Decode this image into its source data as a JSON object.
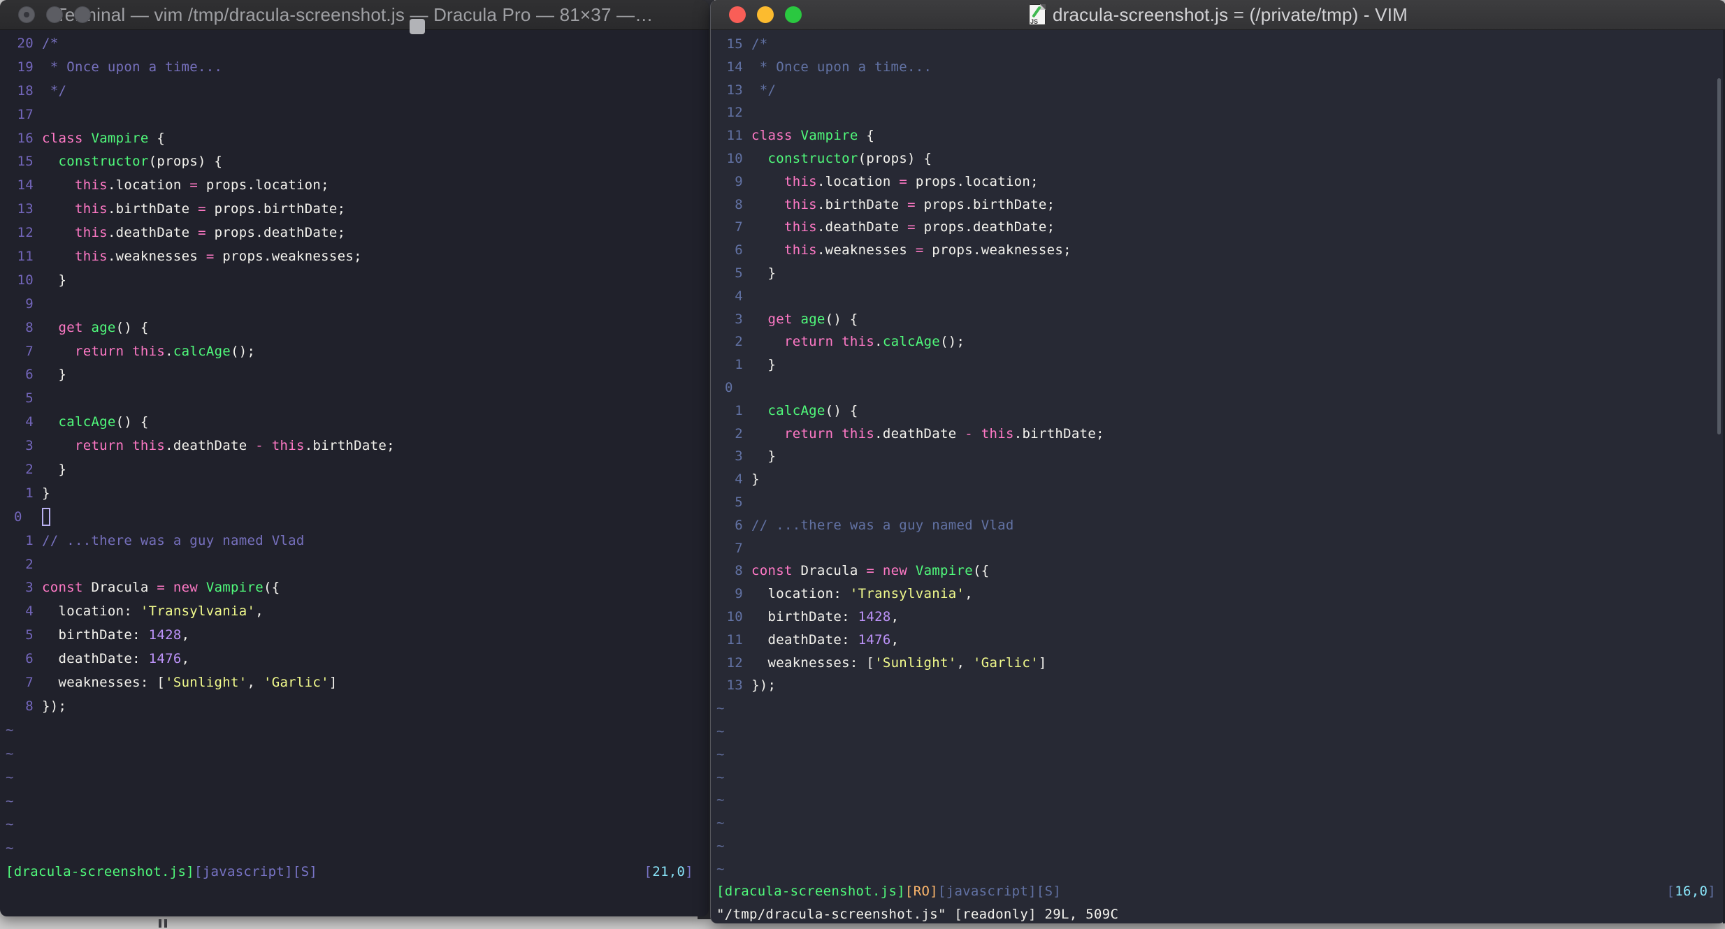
{
  "colors": {
    "left_background": "#20212b",
    "right_background": "#272934",
    "foreground": "#f4f3ee",
    "pink": "#ff79c6",
    "green": "#50fa7b",
    "yellow": "#f1fa8c",
    "purple": "#bd93f9",
    "left_comment": "#7670bd",
    "right_comment": "#6272a4",
    "cyan": "#8be9fd",
    "orange": "#ffb86c",
    "traffic_red": "#f95e57",
    "traffic_yellow": "#fcbb2f",
    "traffic_green": "#2ac840"
  },
  "tilde_char": "~",
  "code": {
    "lines": [
      [
        [
          "c",
          "/*"
        ]
      ],
      [
        [
          "c",
          " * Once upon a time..."
        ]
      ],
      [
        [
          "c",
          " */"
        ]
      ],
      [],
      [
        [
          "k",
          "class"
        ],
        [
          "d",
          " "
        ],
        [
          "f",
          "Vampire"
        ],
        [
          "d",
          " {"
        ]
      ],
      [
        [
          "d",
          "  "
        ],
        [
          "f",
          "constructor"
        ],
        [
          "d",
          "(props) {"
        ]
      ],
      [
        [
          "d",
          "    "
        ],
        [
          "k",
          "this"
        ],
        [
          "d",
          ".location "
        ],
        [
          "k",
          "="
        ],
        [
          "d",
          " props.location;"
        ]
      ],
      [
        [
          "d",
          "    "
        ],
        [
          "k",
          "this"
        ],
        [
          "d",
          ".birthDate "
        ],
        [
          "k",
          "="
        ],
        [
          "d",
          " props.birthDate;"
        ]
      ],
      [
        [
          "d",
          "    "
        ],
        [
          "k",
          "this"
        ],
        [
          "d",
          ".deathDate "
        ],
        [
          "k",
          "="
        ],
        [
          "d",
          " props.deathDate;"
        ]
      ],
      [
        [
          "d",
          "    "
        ],
        [
          "k",
          "this"
        ],
        [
          "d",
          ".weaknesses "
        ],
        [
          "k",
          "="
        ],
        [
          "d",
          " props.weaknesses;"
        ]
      ],
      [
        [
          "d",
          "  }"
        ]
      ],
      [],
      [
        [
          "d",
          "  "
        ],
        [
          "k",
          "get"
        ],
        [
          "d",
          " "
        ],
        [
          "f",
          "age"
        ],
        [
          "d",
          "() {"
        ]
      ],
      [
        [
          "d",
          "    "
        ],
        [
          "k",
          "return"
        ],
        [
          "d",
          " "
        ],
        [
          "k",
          "this"
        ],
        [
          "d",
          "."
        ],
        [
          "f",
          "calcAge"
        ],
        [
          "d",
          "();"
        ]
      ],
      [
        [
          "d",
          "  }"
        ]
      ],
      [],
      [
        [
          "d",
          "  "
        ],
        [
          "f",
          "calcAge"
        ],
        [
          "d",
          "() {"
        ]
      ],
      [
        [
          "d",
          "    "
        ],
        [
          "k",
          "return"
        ],
        [
          "d",
          " "
        ],
        [
          "k",
          "this"
        ],
        [
          "d",
          ".deathDate "
        ],
        [
          "k",
          "-"
        ],
        [
          "d",
          " "
        ],
        [
          "k",
          "this"
        ],
        [
          "d",
          ".birthDate;"
        ]
      ],
      [
        [
          "d",
          "  }"
        ]
      ],
      [
        [
          "d",
          "}"
        ]
      ],
      [],
      [
        [
          "c",
          "// ...there was a guy named Vlad"
        ]
      ],
      [],
      [
        [
          "k",
          "const"
        ],
        [
          "d",
          " Dracula "
        ],
        [
          "k",
          "="
        ],
        [
          "d",
          " "
        ],
        [
          "k",
          "new"
        ],
        [
          "d",
          " "
        ],
        [
          "f",
          "Vampire"
        ],
        [
          "d",
          "({"
        ]
      ],
      [
        [
          "d",
          "  location: "
        ],
        [
          "s",
          "'Transylvania'"
        ],
        [
          "d",
          ","
        ]
      ],
      [
        [
          "d",
          "  birthDate: "
        ],
        [
          "n",
          "1428"
        ],
        [
          "d",
          ","
        ]
      ],
      [
        [
          "d",
          "  deathDate: "
        ],
        [
          "n",
          "1476"
        ],
        [
          "d",
          ","
        ]
      ],
      [
        [
          "d",
          "  weaknesses: ["
        ],
        [
          "s",
          "'Sunlight'"
        ],
        [
          "d",
          ", "
        ],
        [
          "s",
          "'Garlic'"
        ],
        [
          "d",
          "]"
        ]
      ],
      [
        [
          "d",
          "});"
        ]
      ]
    ]
  },
  "left_window": {
    "title": "Terminal — vim /tmp/dracula-screenshot.js — Dracula Pro — 81×37 —…",
    "numbers": [
      "20",
      "19",
      "18",
      "17",
      "16",
      "15",
      "14",
      "13",
      "12",
      "11",
      "10",
      "9",
      "8",
      "7",
      "6",
      "5",
      "4",
      "3",
      "2",
      "1",
      "0",
      "1",
      "2",
      "3",
      "4",
      "5",
      "6",
      "7",
      "8"
    ],
    "cursor_index": 20,
    "cursor_style": "hollow",
    "tilde_count": 6,
    "status": {
      "segments": [
        [
          "g",
          "[dracula-screenshot.js]"
        ],
        [
          "m",
          "[javascript][S]"
        ]
      ],
      "position": [
        [
          "m",
          "["
        ],
        [
          "cyl",
          "21,0"
        ],
        [
          "m",
          "]"
        ]
      ]
    }
  },
  "right_window": {
    "title": "dracula-screenshot.js = (/private/tmp) - VIM",
    "doc_icon_label": "JS",
    "numbers": [
      "15",
      "14",
      "13",
      "12",
      "11",
      "10",
      "9",
      "8",
      "7",
      "6",
      "5",
      "4",
      "3",
      "2",
      "1",
      "0",
      "1",
      "2",
      "3",
      "4",
      "5",
      "6",
      "7",
      "8",
      "9",
      "10",
      "11",
      "12",
      "13"
    ],
    "cursor_index": 15,
    "cursor_style": "none",
    "tilde_count": 8,
    "status": {
      "segments": [
        [
          "g",
          "[dracula-screenshot.js]"
        ],
        [
          "o",
          "[RO]"
        ],
        [
          "sl",
          "[javascript][S]"
        ]
      ],
      "position": [
        [
          "sl",
          "["
        ],
        [
          "cyr",
          "16,0"
        ],
        [
          "sl",
          "]"
        ]
      ]
    },
    "cmdline": "\"/tmp/dracula-screenshot.js\" [readonly] 29L, 509C"
  }
}
